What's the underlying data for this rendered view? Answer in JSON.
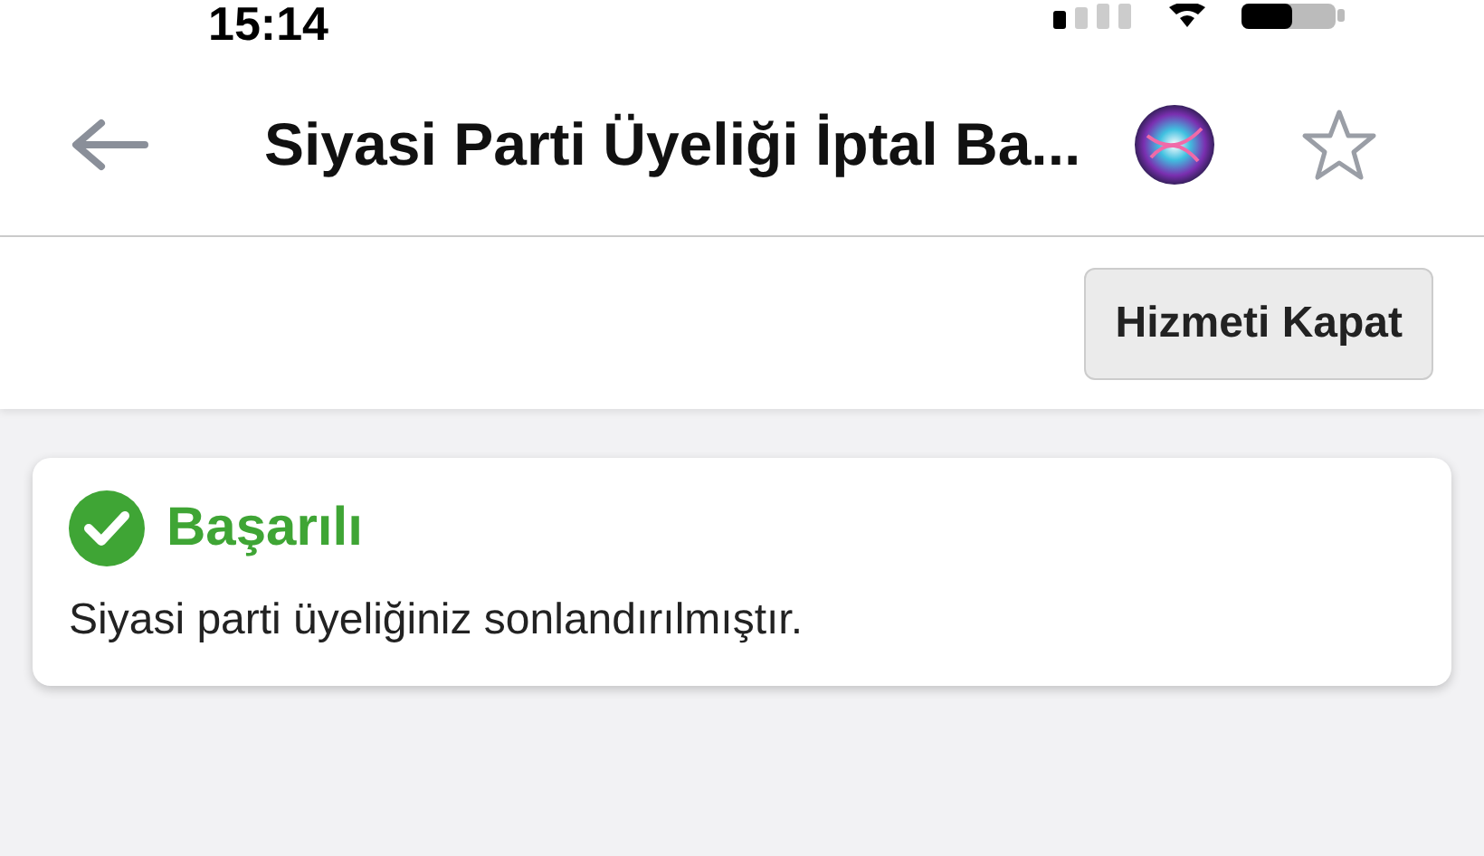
{
  "status_bar": {
    "time": "15:14"
  },
  "header": {
    "title": "Siyasi Parti Üyeliği İptal Ba..."
  },
  "toolbar": {
    "button": "Hizmeti Kapat"
  },
  "alert": {
    "kind": "success",
    "title": "Başarılı",
    "message": "Siyasi parti üyeliğiniz sonlandırılmıştır."
  }
}
